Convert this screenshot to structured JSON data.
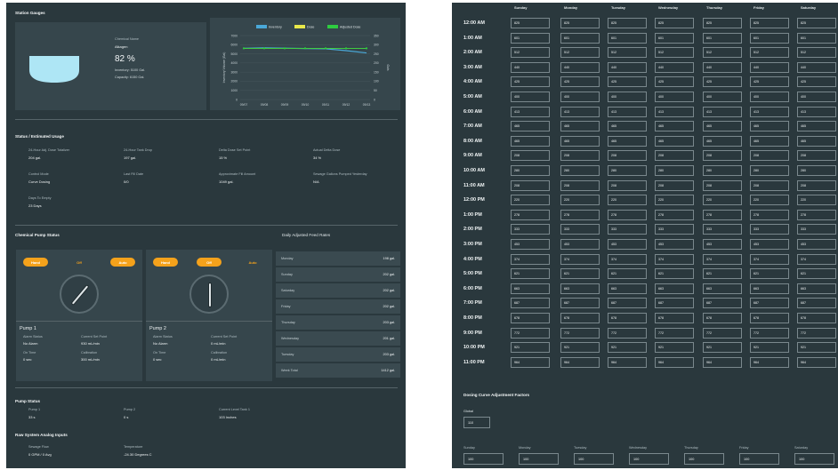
{
  "station_gauges": {
    "title": "Station Gauges",
    "tank": {
      "chemical_name_label": "Chemical Name",
      "chemical_name": "Alkagen",
      "percent": "82 %",
      "inventory": "Inventory: 5100 Gal.",
      "capacity": "Capacity: 6150 Gal."
    }
  },
  "chart_data": {
    "type": "line",
    "legend": [
      "Inventory",
      "Dose",
      "Adjusted Dose"
    ],
    "legend_colors": [
      "#4aa8d8",
      "#e8e84a",
      "#2ecc40"
    ],
    "x": [
      "09/07",
      "09/08",
      "09/09",
      "09/10",
      "09/11",
      "09/12",
      "09/13"
    ],
    "ylabel_left": "Inventory Volume (Gal)",
    "ylabel_right": "Gals",
    "ylim_left": [
      0,
      7000
    ],
    "ylim_right": [
      0,
      350
    ],
    "yticks_left": [
      "0",
      "1000",
      "2000",
      "3000",
      "4000",
      "5000",
      "6000",
      "7000"
    ],
    "yticks_right": [
      "0",
      "50",
      "100",
      "150",
      "200",
      "250",
      "300",
      "350"
    ],
    "series": [
      {
        "name": "Inventory",
        "axis": "left",
        "values": [
          5600,
          5650,
          5620,
          5580,
          5550,
          5350,
          5100
        ]
      },
      {
        "name": "Dose",
        "axis": "right",
        "values": [
          280,
          280,
          280,
          280,
          280,
          280,
          280
        ]
      },
      {
        "name": "Adjusted Dose",
        "axis": "right",
        "values": [
          280,
          280,
          280,
          280,
          280,
          280,
          280
        ]
      }
    ]
  },
  "usage": {
    "title": "Status / Estimated Usage",
    "items": [
      {
        "label": "24-Hour Adj. Dose Totalizer",
        "value": "204 gal."
      },
      {
        "label": "24-Hour Tank Drop",
        "value": "197 gal."
      },
      {
        "label": "Delta Dose Set Point",
        "value": "15 %"
      },
      {
        "label": "Actual Delta Dose",
        "value": "34 %"
      },
      {
        "label": "Control Mode",
        "value": "Curve Dosing"
      },
      {
        "label": "Last Fill Date",
        "value": "0/0"
      },
      {
        "label": "Approximate Fill Amount",
        "value": "1049 gal."
      },
      {
        "label": "Sewage Gallons Pumped Yesterday",
        "value": "N/A"
      },
      {
        "label": "Days To Empty",
        "value": "23 Days"
      }
    ]
  },
  "pump_status_section": {
    "title": "Chemical Pump Status"
  },
  "pumps": [
    {
      "hand": "Hand",
      "off": "Off",
      "auto": "Auto",
      "active": "off",
      "name": "Pump 1",
      "alarm_label": "Alarm Status",
      "alarm": "No Alarm",
      "setpoint_label": "Current Set Point",
      "setpoint": "930 mL/min",
      "ontime_label": "On Time",
      "ontime": "0 sec",
      "cal_label": "Calibration",
      "cal": "300 mL/min"
    },
    {
      "hand": "Hand",
      "off": "Off",
      "auto": "Auto",
      "active": "auto",
      "name": "Pump 2",
      "alarm_label": "Alarm Status",
      "alarm": "No Alarm",
      "setpoint_label": "Current Set Point",
      "setpoint": "0 mL/min",
      "ontime_label": "On Time",
      "ontime": "0 sec",
      "cal_label": "Calibration",
      "cal": "0 mL/min"
    }
  ],
  "feed_rates": {
    "title": "Daily Adjusted Feed Rates",
    "rows": [
      {
        "day": "Monday",
        "amount": "198 gal."
      },
      {
        "day": "Sunday",
        "amount": "202 gal."
      },
      {
        "day": "Saturday",
        "amount": "202 gal."
      },
      {
        "day": "Friday",
        "amount": "202 gal."
      },
      {
        "day": "Thursday",
        "amount": "203 gal."
      },
      {
        "day": "Wednesday",
        "amount": "201 gal."
      },
      {
        "day": "Tuesday",
        "amount": "203 gal."
      },
      {
        "day": "Week Total",
        "amount": "1412 gal."
      }
    ]
  },
  "pump_status": {
    "title": "Pump Status",
    "items": [
      {
        "label": "Pump 1",
        "value": "33 s"
      },
      {
        "label": "Pump 2",
        "value": "0 s"
      },
      {
        "label": "Current Level Tank 1",
        "value": "103 Inches"
      }
    ]
  },
  "raw_inputs": {
    "title": "Raw System Analog Inputs",
    "items": [
      {
        "label": "Sewage Flow",
        "value": "0 GPM / 0 Avg"
      },
      {
        "label": "Temperature",
        "value": "-24.30 Degrees C"
      }
    ]
  },
  "schedule": {
    "days": [
      "Sunday",
      "Monday",
      "Tuesday",
      "Wednesday",
      "Thursday",
      "Friday",
      "Saturday"
    ],
    "rows": [
      {
        "time": "12:00 AM",
        "value": "825"
      },
      {
        "time": "1:00 AM",
        "value": "601"
      },
      {
        "time": "2:00 AM",
        "value": "512"
      },
      {
        "time": "3:00 AM",
        "value": "440"
      },
      {
        "time": "4:00 AM",
        "value": "425"
      },
      {
        "time": "5:00 AM",
        "value": "400"
      },
      {
        "time": "6:00 AM",
        "value": "413"
      },
      {
        "time": "7:00 AM",
        "value": "465"
      },
      {
        "time": "8:00 AM",
        "value": "465"
      },
      {
        "time": "9:00 AM",
        "value": "208"
      },
      {
        "time": "10:00 AM",
        "value": "280"
      },
      {
        "time": "11:00 AM",
        "value": "208"
      },
      {
        "time": "12:00 PM",
        "value": "220"
      },
      {
        "time": "1:00 PM",
        "value": "278"
      },
      {
        "time": "2:00 PM",
        "value": "333"
      },
      {
        "time": "3:00 PM",
        "value": "453"
      },
      {
        "time": "4:00 PM",
        "value": "374"
      },
      {
        "time": "5:00 PM",
        "value": "621"
      },
      {
        "time": "6:00 PM",
        "value": "663"
      },
      {
        "time": "7:00 PM",
        "value": "687"
      },
      {
        "time": "8:00 PM",
        "value": "678"
      },
      {
        "time": "9:00 PM",
        "value": "772"
      },
      {
        "time": "10:00 PM",
        "value": "921"
      },
      {
        "time": "11:00 PM",
        "value": "964"
      }
    ]
  },
  "adjustment": {
    "title": "Dosing Curve Adjustment Factors",
    "global_label": "Global",
    "global_value": "110",
    "days": [
      {
        "day": "Sunday",
        "value": "100"
      },
      {
        "day": "Monday",
        "value": "100"
      },
      {
        "day": "Tuesday",
        "value": "100"
      },
      {
        "day": "Wednesday",
        "value": "100"
      },
      {
        "day": "Thursday",
        "value": "100"
      },
      {
        "day": "Friday",
        "value": "100"
      },
      {
        "day": "Saturday",
        "value": "100"
      }
    ]
  }
}
